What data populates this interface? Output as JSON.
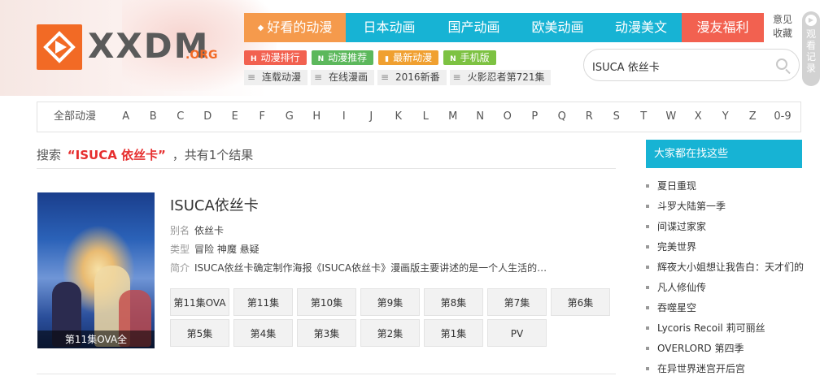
{
  "logo": {
    "text": "XXDM",
    "suffix": ".ORG"
  },
  "main_nav": [
    {
      "label": "好看的动漫",
      "icon": "diamond-icon",
      "color": "#f59a4c",
      "width": 125
    },
    {
      "label": "日本动画",
      "color": "#17b3d4",
      "width": 107
    },
    {
      "label": "国产动画",
      "color": "#17b3d4",
      "width": 101
    },
    {
      "label": "欧美动画",
      "color": "#17b3d4",
      "width": 105
    },
    {
      "label": "动漫美文",
      "color": "#17b3d4",
      "width": 100
    },
    {
      "label": "漫友福利",
      "color": "#f26150",
      "width": 101
    }
  ],
  "favorite": "意见收藏",
  "history": "观看记录",
  "sub_nav": [
    {
      "label": "动漫排行",
      "badge": "H",
      "color": "#f26150"
    },
    {
      "label": "动漫推荐",
      "badge": "N",
      "color": "#5cb85c"
    },
    {
      "label": "最新动漫",
      "badge": "▮",
      "color": "#f0a030"
    },
    {
      "label": "手机版",
      "badge": "N",
      "color": "#7dc242"
    }
  ],
  "tags": [
    "连载动漫",
    "在线漫画",
    "2016新番",
    "火影忍者第721集"
  ],
  "search": {
    "value": "ISUCA 依丝卡",
    "placeholder": ""
  },
  "alphabet": {
    "all": "全部动漫",
    "letters": [
      "A",
      "B",
      "C",
      "D",
      "E",
      "F",
      "G",
      "H",
      "I",
      "J",
      "K",
      "L",
      "M",
      "N",
      "O",
      "P",
      "Q",
      "R",
      "S",
      "T",
      "W",
      "X",
      "Y",
      "Z"
    ],
    "num": "0-9"
  },
  "result_summary": {
    "prefix": "搜索",
    "keyword": "“ISUCA 依丝卡”",
    "suffix": "，共有1个结果"
  },
  "result": {
    "title": "ISUCA依丝卡",
    "poster_caption": "第11集OVA全",
    "alias_label": "别名",
    "alias": "依丝卡",
    "type_label": "类型",
    "type": "冒险 神魔 悬疑",
    "intro_label": "简介",
    "intro": "ISUCA依丝卡确定制作海报《ISUCA依丝卡》漫画版主要讲述的是一个人生活的贫…",
    "episodes": [
      "第11集OVA",
      "第11集",
      "第10集",
      "第9集",
      "第8集",
      "第7集",
      "第6集",
      "第5集",
      "第4集",
      "第3集",
      "第2集",
      "第1集",
      "PV"
    ]
  },
  "sidebar": {
    "title": "大家都在找这些",
    "items": [
      "夏日重现",
      "斗罗大陆第一季",
      "间谍过家家",
      "完美世界",
      "辉夜大小姐想让我告白：天才们的",
      "凡人修仙传",
      "吞噬星空",
      "Lycoris Recoil 莉可丽丝",
      "OVERLORD 第四季",
      "在异世界迷宫开后宫"
    ]
  }
}
